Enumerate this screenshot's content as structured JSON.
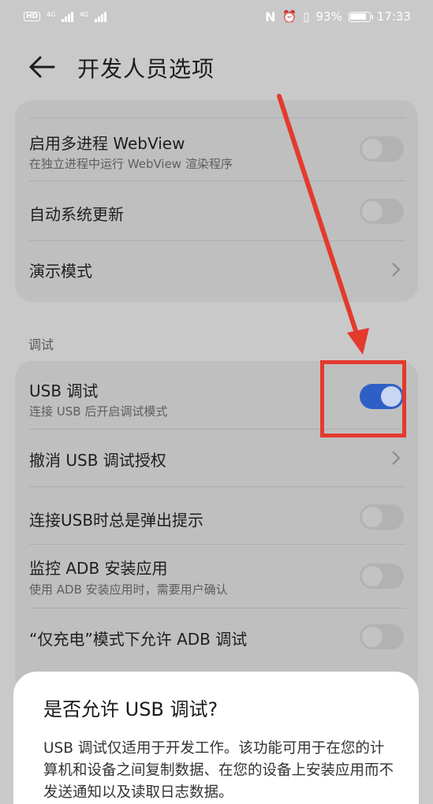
{
  "status_bar": {
    "hd_label": "HD",
    "net1": "4G",
    "net2": "4G",
    "battery_percent": "93%",
    "battery_level": 0.93,
    "time": "17:33"
  },
  "header": {
    "back_icon": "arrow-left",
    "title": "开发人员选项"
  },
  "card1": {
    "multiprocess_webview": {
      "title": "启用多进程 WebView",
      "subtitle": "在独立进程中运行 WebView 渲染程序",
      "on": false
    },
    "auto_update": {
      "title": "自动系统更新",
      "on": false
    },
    "demo_mode": {
      "title": "演示模式"
    }
  },
  "debug_section": {
    "label": "调试",
    "usb_debugging": {
      "title": "USB 调试",
      "subtitle": "连接 USB 后开启调试模式",
      "on": true
    },
    "revoke_usb": {
      "title": "撤消 USB 调试授权"
    },
    "usb_prompt": {
      "title": "连接USB时总是弹出提示",
      "on": false
    },
    "monitor_adb": {
      "title": "监控 ADB 安装应用",
      "subtitle": "使用 ADB 安装应用时，需要用户确认",
      "on": false
    },
    "charge_only_adb": {
      "title": "“仅充电”模式下允许 ADB 调试",
      "on": false
    }
  },
  "dialog": {
    "title": "是否允许 USB 调试?",
    "body": "USB 调试仅适用于开发工作。该功能可用于在您的计算机和设备之间复制数据、在您的设备上安装应用而不发送通知以及读取日志数据。"
  },
  "colors": {
    "toggle_on": "#2f5fc6",
    "annotation_red": "#e43a2e"
  }
}
